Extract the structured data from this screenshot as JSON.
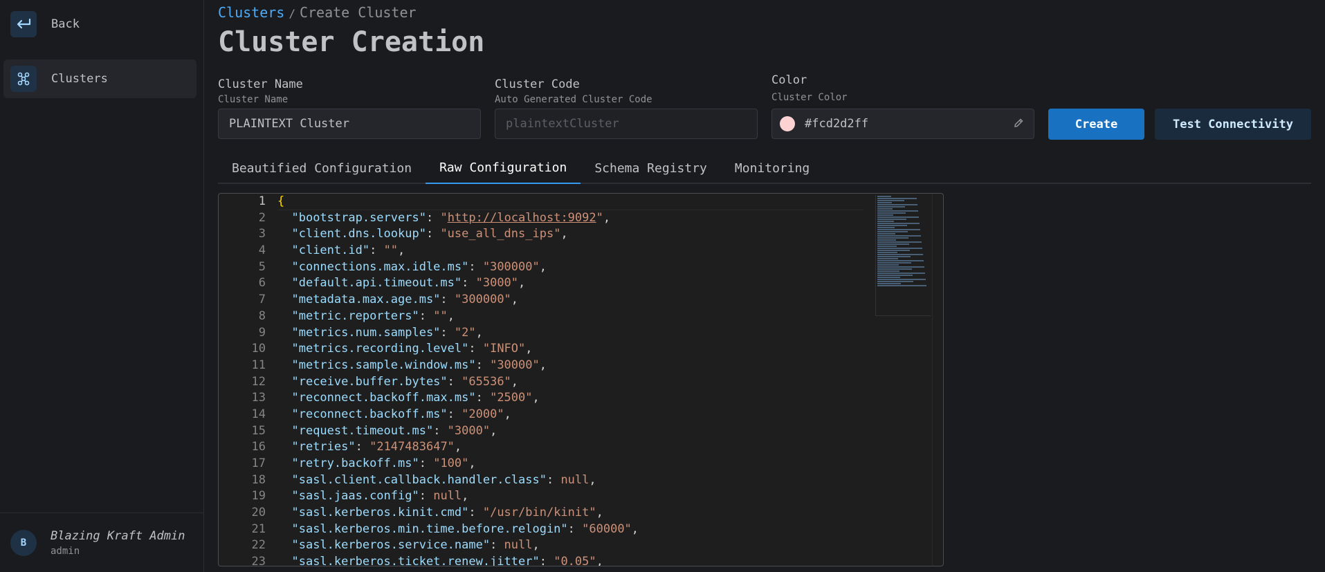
{
  "sidebar": {
    "back_label": "Back",
    "clusters_label": "Clusters",
    "user": {
      "initial": "B",
      "name": "Blazing Kraft Admin",
      "role": "admin"
    }
  },
  "breadcrumb": {
    "link": "Clusters",
    "separator": "/",
    "current": "Create Cluster"
  },
  "page_title": "Cluster Creation",
  "form": {
    "cluster_name": {
      "label": "Cluster Name",
      "description": "Cluster Name",
      "value": "PLAINTEXT Cluster"
    },
    "cluster_code": {
      "label": "Cluster Code",
      "description": "Auto Generated Cluster Code",
      "placeholder": "plaintextCluster"
    },
    "color": {
      "label": "Color",
      "description": "Cluster Color",
      "value": "#fcd2d2ff",
      "swatch": "#fcd2d2"
    }
  },
  "buttons": {
    "create": "Create",
    "test": "Test Connectivity"
  },
  "tabs": [
    "Beautified Configuration",
    "Raw Configuration",
    "Schema Registry",
    "Monitoring"
  ],
  "active_tab": "Raw Configuration",
  "editor": {
    "lines": [
      {
        "t": "brace",
        "text": "{"
      },
      {
        "k": "bootstrap.servers",
        "v": "http://localhost:9092",
        "url": true
      },
      {
        "k": "client.dns.lookup",
        "v": "use_all_dns_ips"
      },
      {
        "k": "client.id",
        "v": ""
      },
      {
        "k": "connections.max.idle.ms",
        "v": "300000"
      },
      {
        "k": "default.api.timeout.ms",
        "v": "3000"
      },
      {
        "k": "metadata.max.age.ms",
        "v": "300000"
      },
      {
        "k": "metric.reporters",
        "v": ""
      },
      {
        "k": "metrics.num.samples",
        "v": "2"
      },
      {
        "k": "metrics.recording.level",
        "v": "INFO"
      },
      {
        "k": "metrics.sample.window.ms",
        "v": "30000"
      },
      {
        "k": "receive.buffer.bytes",
        "v": "65536"
      },
      {
        "k": "reconnect.backoff.max.ms",
        "v": "2500"
      },
      {
        "k": "reconnect.backoff.ms",
        "v": "2000"
      },
      {
        "k": "request.timeout.ms",
        "v": "3000"
      },
      {
        "k": "retries",
        "v": "2147483647"
      },
      {
        "k": "retry.backoff.ms",
        "v": "100"
      },
      {
        "k": "sasl.client.callback.handler.class",
        "null": true
      },
      {
        "k": "sasl.jaas.config",
        "null": true
      },
      {
        "k": "sasl.kerberos.kinit.cmd",
        "v": "/usr/bin/kinit"
      },
      {
        "k": "sasl.kerberos.min.time.before.relogin",
        "v": "60000"
      },
      {
        "k": "sasl.kerberos.service.name",
        "null": true
      },
      {
        "k": "sasl.kerberos.ticket.renew.jitter",
        "v": "0.05"
      }
    ]
  }
}
